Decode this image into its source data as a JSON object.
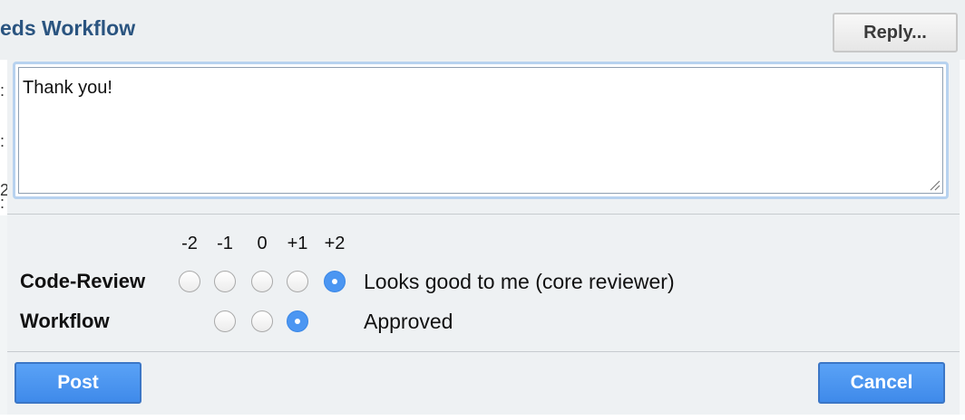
{
  "header": {
    "title": "eds Workflow",
    "reply_label": "Reply..."
  },
  "background_fragments": [
    ":",
    ":",
    "2",
    ":"
  ],
  "reply": {
    "message": "Thank you!"
  },
  "voting": {
    "score_headers": [
      "-2",
      "-1",
      "0",
      "+1",
      "+2"
    ],
    "categories": [
      {
        "label": "Code-Review",
        "options": [
          "-2",
          "-1",
          "0",
          "+1",
          "+2"
        ],
        "selected": "+2",
        "selected_text": "Looks good to me (core reviewer)"
      },
      {
        "label": "Workflow",
        "options": [
          "-1",
          "0",
          "+1"
        ],
        "selected": "+1",
        "selected_text": "Approved"
      }
    ]
  },
  "actions": {
    "post_label": "Post",
    "cancel_label": "Cancel"
  },
  "colors": {
    "accent": "#4b96f2",
    "title": "#2a5480",
    "focus_ring": "#b7d2ef"
  }
}
